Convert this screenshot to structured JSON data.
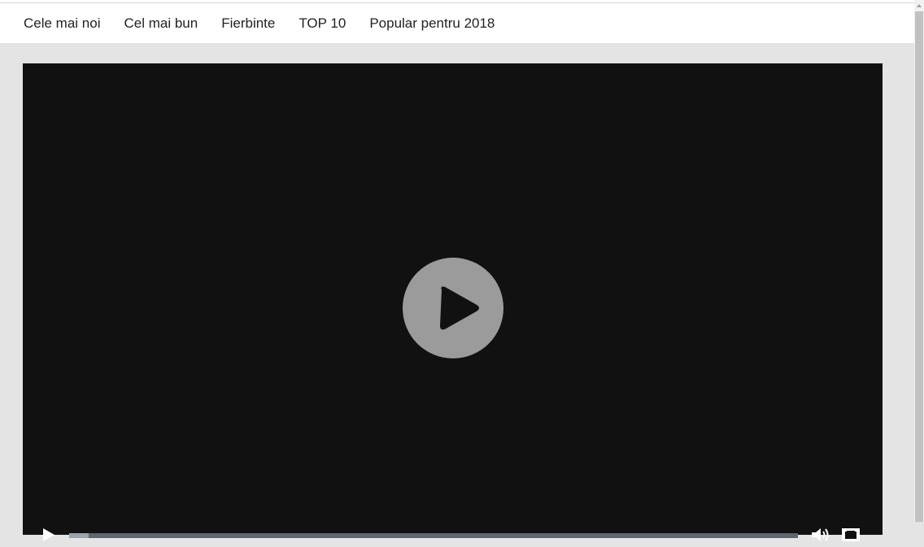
{
  "nav": {
    "items": [
      {
        "label": "Cele mai noi"
      },
      {
        "label": "Cel mai bun"
      },
      {
        "label": "Fierbinte"
      },
      {
        "label": "TOP 10"
      },
      {
        "label": "Popular pentru 2018"
      }
    ]
  },
  "player": {
    "progress_percent": 2.7,
    "colors": {
      "background": "#111111",
      "big_play_circle": "#9b9b9b",
      "track": "#5b6670",
      "fill": "#9aa4ac"
    },
    "icons": {
      "big_play": "play-icon",
      "control_play": "play-icon",
      "volume": "volume-icon",
      "fullscreen": "fullscreen-icon"
    }
  }
}
